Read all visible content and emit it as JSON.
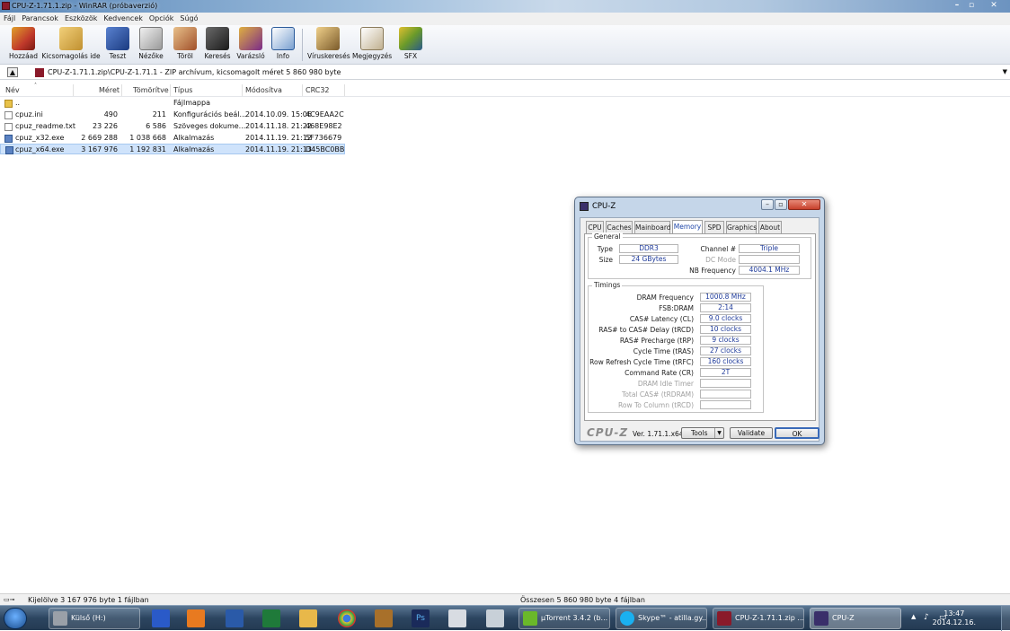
{
  "window": {
    "title": "CPU-Z-1.71.1.zip - WinRAR (próbaverzió)"
  },
  "menu": [
    "Fájl",
    "Parancsok",
    "Eszközök",
    "Kedvencek",
    "Opciók",
    "Súgó"
  ],
  "toolbar": [
    {
      "label": "Hozzáad",
      "icon": "add-archive-icon",
      "color": "#c0392b"
    },
    {
      "label": "Kicsomagolás ide",
      "icon": "extract-folder-icon",
      "color": "#d4a84a"
    },
    {
      "label": "Teszt",
      "icon": "test-book-icon",
      "color": "#2850a0"
    },
    {
      "label": "Nézőke",
      "icon": "viewer-glasses-icon",
      "color": "#8a8a8a"
    },
    {
      "label": "Töröl",
      "icon": "delete-icon",
      "color": "#b0502a"
    },
    {
      "label": "Keresés",
      "icon": "binoculars-icon",
      "color": "#3a3a3a"
    },
    {
      "label": "Varázsló",
      "icon": "wizard-icon",
      "color": "#7a2a8a"
    },
    {
      "label": "Info",
      "icon": "info-icon",
      "color": "#2a5a9a"
    },
    {
      "label": "Víruskeresés",
      "icon": "virus-scan-icon",
      "color": "#a07a2a"
    },
    {
      "label": "Megjegyzés",
      "icon": "comment-icon",
      "color": "#8a7a5a"
    },
    {
      "label": "SFX",
      "icon": "sfx-icon",
      "color": "#6a9a2a"
    }
  ],
  "address": {
    "path": "CPU-Z-1.71.1.zip\\CPU-Z-1.71.1 - ZIP archívum, kicsomagolt méret 5 860 980 byte"
  },
  "columns": [
    "Név",
    "Méret",
    "Tömörítve",
    "Típus",
    "Módosítva",
    "CRC32"
  ],
  "files": [
    {
      "name": "..",
      "size": "",
      "packed": "",
      "type": "Fájlmappa",
      "modified": "",
      "crc": "",
      "icon": "folder-icon"
    },
    {
      "name": "cpuz.ini",
      "size": "490",
      "packed": "211",
      "type": "Konfigurációs beál...",
      "modified": "2014.10.09. 15:06",
      "crc": "4C9EAA2C",
      "icon": "ini-file-icon"
    },
    {
      "name": "cpuz_readme.txt",
      "size": "23 226",
      "packed": "6 586",
      "type": "Szöveges dokume...",
      "modified": "2014.11.18. 21:22",
      "crc": "468E98E2",
      "icon": "text-file-icon"
    },
    {
      "name": "cpuz_x32.exe",
      "size": "2 669 288",
      "packed": "1 038 668",
      "type": "Alkalmazás",
      "modified": "2014.11.19. 21:12",
      "crc": "5F736679",
      "icon": "exe-file-icon"
    },
    {
      "name": "cpuz_x64.exe",
      "size": "3 167 976",
      "packed": "1 192 831",
      "type": "Alkalmazás",
      "modified": "2014.11.19. 21:13",
      "crc": "D45BC0BB",
      "icon": "exe-file-icon",
      "selected": true
    }
  ],
  "status": {
    "left": "Kijelölve 3 167 976 byte 1 fájlban",
    "right": "Összesen 5 860 980 byte 4 fájlban"
  },
  "taskbar": {
    "drive": "Külső (H:)",
    "tasks": [
      "µTorrent 3.4.2  (b...",
      "Skype™ - atilla.gy...",
      "CPU-Z-1.71.1.zip ...",
      "CPU-Z"
    ],
    "time": "13:47",
    "date": "2014.12.16."
  },
  "cpuz": {
    "title": "CPU-Z",
    "tabs": [
      "CPU",
      "Caches",
      "Mainboard",
      "Memory",
      "SPD",
      "Graphics",
      "About"
    ],
    "active_tab": "Memory",
    "general_label": "General",
    "general": {
      "type_label": "Type",
      "type": "DDR3",
      "size_label": "Size",
      "size": "24 GBytes",
      "channel_label": "Channel #",
      "channel": "Triple",
      "dcmode_label": "DC Mode",
      "dcmode": "",
      "nbfreq_label": "NB Frequency",
      "nbfreq": "4004.1 MHz"
    },
    "timings_label": "Timings",
    "timings": [
      {
        "label": "DRAM Frequency",
        "value": "1000.8 MHz",
        "dim": false
      },
      {
        "label": "FSB:DRAM",
        "value": "2:14",
        "dim": false
      },
      {
        "label": "CAS# Latency (CL)",
        "value": "9.0 clocks",
        "dim": false
      },
      {
        "label": "RAS# to CAS# Delay (tRCD)",
        "value": "10 clocks",
        "dim": false
      },
      {
        "label": "RAS# Precharge (tRP)",
        "value": "9 clocks",
        "dim": false
      },
      {
        "label": "Cycle Time (tRAS)",
        "value": "27 clocks",
        "dim": false
      },
      {
        "label": "Row Refresh Cycle Time (tRFC)",
        "value": "160 clocks",
        "dim": false
      },
      {
        "label": "Command Rate (CR)",
        "value": "2T",
        "dim": false
      },
      {
        "label": "DRAM Idle Timer",
        "value": "",
        "dim": true
      },
      {
        "label": "Total CAS# (tRDRAM)",
        "value": "",
        "dim": true
      },
      {
        "label": "Row To Column (tRCD)",
        "value": "",
        "dim": true
      }
    ],
    "logo": "CPU-Z",
    "version": "Ver. 1.71.1.x64",
    "tools_button": "Tools",
    "validate_button": "Validate",
    "ok_button": "OK"
  }
}
